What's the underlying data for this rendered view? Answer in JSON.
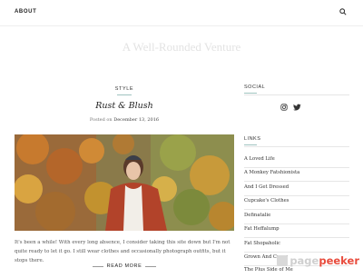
{
  "header": {
    "about_label": "ABOUT",
    "search_icon": "search-icon"
  },
  "site": {
    "title": "A Well-Rounded Venture"
  },
  "post": {
    "category": "STYLE",
    "title": "Rust & Blush",
    "posted_on_label": "Posted on",
    "date": "December 13, 2016",
    "excerpt": "It's been a while! With every long absence, I consider taking this site down but I'm not quite ready to let it go. I still wear clothes and occasionally photograph outfits, but it stops there.",
    "read_more": "READ MORE"
  },
  "sidebar": {
    "social_heading": "SOCIAL",
    "social_icons": [
      "instagram-icon",
      "twitter-icon"
    ],
    "links_heading": "LINKS",
    "links": [
      "A Loved Life",
      "A Monkey Fatshionista",
      "And I Get Dressed",
      "Cupcake's Clothes",
      "Definatalie",
      "Fat Heffalump",
      "Fat Shopaholic",
      "Grown And Curvy",
      "The Plus Side of Me"
    ]
  },
  "watermark": {
    "part1": "page",
    "part2": "peeker"
  },
  "colors": {
    "accent_line": "#a0c4c0",
    "watermark_red": "#e84c3d"
  }
}
